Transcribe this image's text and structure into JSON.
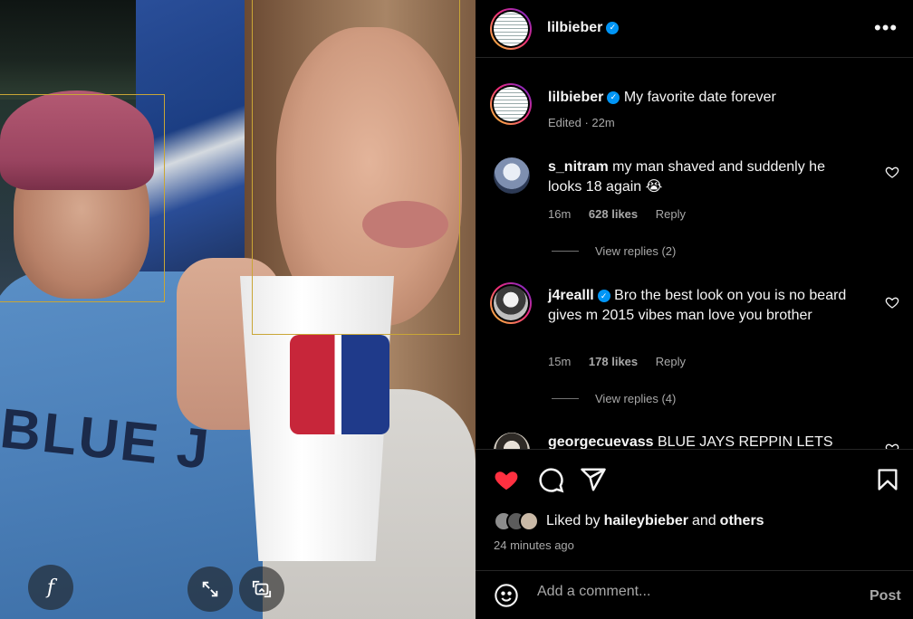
{
  "post": {
    "username": "lilbieber",
    "verified": true,
    "caption": "My favorite date forever",
    "caption_meta": "Edited · 22m"
  },
  "photo_overlay": {
    "jersey_text": "BLUE J",
    "buttons": [
      {
        "icon": "f"
      },
      {
        "icon": "expand-icon"
      },
      {
        "icon": "crop-icon"
      }
    ]
  },
  "comments": [
    {
      "username": "s_nitram",
      "verified": false,
      "text": "my man shaved and suddenly he looks 18 again 😭",
      "time": "16m",
      "likes": "628 likes",
      "reply": "Reply",
      "view_replies": "View replies (2)"
    },
    {
      "username": "j4realll",
      "verified": true,
      "text": "Bro the best look on you is no beard gives m 2015 vibes man love you brother",
      "time": "15m",
      "likes": "178 likes",
      "reply": "Reply",
      "view_replies": "View replies (4)"
    },
    {
      "username": "georgecuevass",
      "verified": false,
      "text": "BLUE JAYS REPPIN LETS"
    }
  ],
  "likes": {
    "prefix": "Liked by ",
    "user": "haileybieber",
    "middle": " and ",
    "others": "others",
    "time": "24 minutes ago"
  },
  "composer": {
    "placeholder": "Add a comment...",
    "post_label": "Post"
  },
  "colors": {
    "background": "#000000",
    "text": "#f5f5f5",
    "muted": "#a8a8a8",
    "like_red": "#ff3040",
    "verified_blue": "#0095f6"
  }
}
